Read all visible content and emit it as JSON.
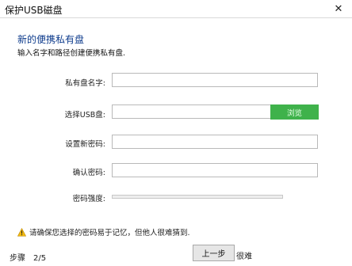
{
  "window": {
    "title": "保护USB磁盘"
  },
  "header": {
    "title": "新的便携私有盘",
    "subtitle": "输入名字和路径创建便携私有盘."
  },
  "form": {
    "name": {
      "label": "私有盘名字:",
      "value": ""
    },
    "usb": {
      "label": "选择USB盘:",
      "value": "",
      "browse_label": "浏览"
    },
    "password": {
      "label": "设置新密码:",
      "value": ""
    },
    "confirm": {
      "label": "确认密码:",
      "value": ""
    },
    "strength": {
      "label": "密码强度:",
      "level": 0
    }
  },
  "warning": {
    "icon": "warning-icon",
    "text": "请确保您选择的密码易于记忆，但他人很难猜到."
  },
  "footer": {
    "step_label": "步骤",
    "step_value": "2/5",
    "prev_label": "上一步",
    "next_label": "很难"
  },
  "colors": {
    "accent_green": "#3fb24b",
    "heading_blue": "#0d3b8c"
  }
}
